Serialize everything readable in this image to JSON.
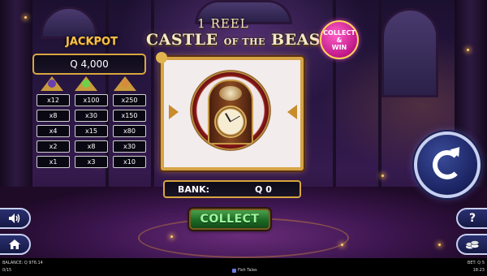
{
  "game": {
    "title_line1": "1 REEL",
    "title_main_a": "CASTLE",
    "title_main_b": "OF THE",
    "title_main_c": "BEAST",
    "badge_collect": "COLLECT",
    "badge_amp": "&",
    "badge_win": "WIN"
  },
  "jackpot": {
    "title": "JACKPOT",
    "value": "Q 4,000",
    "symbol_colors": [
      "#6a3fb0",
      "#6fd04a",
      "#d88c3a"
    ],
    "multipliers": [
      [
        "x12",
        "x100",
        "x250"
      ],
      [
        "x8",
        "x30",
        "x150"
      ],
      [
        "x4",
        "x15",
        "x80"
      ],
      [
        "x2",
        "x8",
        "x30"
      ],
      [
        "x1",
        "x3",
        "x10"
      ]
    ]
  },
  "reel": {
    "symbol": "clock-icon"
  },
  "bank": {
    "label": "BANK:",
    "value": "Q 0"
  },
  "buttons": {
    "collect": "COLLECT",
    "spin_icon": "spin-icon",
    "sound_icon": "speaker-icon",
    "home_icon": "home-icon",
    "help": "?",
    "coins_icon": "coins-icon"
  },
  "status": {
    "balance": "BALANCE: Q 976.14",
    "left_bottom": "0/15",
    "center": "Fish Tales",
    "bet": "BET: Q 5",
    "time": "18:23"
  },
  "colors": {
    "gold": "#d9a640",
    "collect_green": "#1d6a26",
    "spin_blue": "#1a2260",
    "badge_pink": "#c0188a"
  }
}
